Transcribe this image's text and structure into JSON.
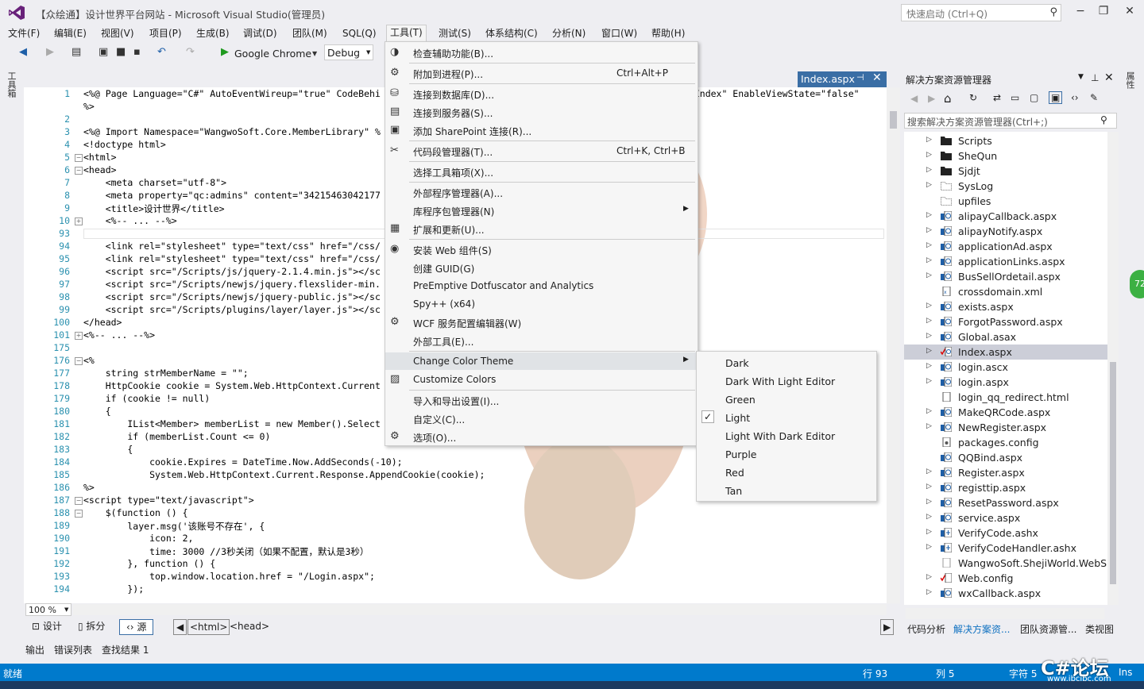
{
  "window": {
    "title": "【众绘通】设计世界平台网站 - Microsoft Visual Studio(管理员)",
    "quick_launch_placeholder": "快速启动 (Ctrl+Q)",
    "minimize": "−",
    "restore": "❐",
    "close": "✕"
  },
  "menu": [
    "文件(F)",
    "编辑(E)",
    "视图(V)",
    "项目(P)",
    "生成(B)",
    "调试(D)",
    "团队(M)",
    "SQL(Q)",
    "工具(T)",
    "测试(S)",
    "体系结构(C)",
    "分析(N)",
    "窗口(W)",
    "帮助(H)"
  ],
  "toolbar": {
    "browser": "Google Chrome",
    "config": "Debug"
  },
  "toolbox_label": "工具箱",
  "document_tab": {
    "label": "Index.aspx",
    "pin": "⊣",
    "close": "✕"
  },
  "editor": {
    "zoom": "100 %",
    "lines": [
      {
        "n": "1",
        "text": "<%@ Page Language=\"C#\" AutoEventWireup=\"true\" CodeBehi"
      },
      {
        "n": "",
        "text": "%>"
      },
      {
        "n": "2",
        "text": ""
      },
      {
        "n": "3",
        "text": "<%@ Import Namespace=\"WangwoSoft.Core.MemberLibrary\" %"
      },
      {
        "n": "4",
        "text": "<!doctype html>"
      },
      {
        "n": "5",
        "text": "<html>"
      },
      {
        "n": "6",
        "text": "<head>"
      },
      {
        "n": "7",
        "text": "    <meta charset=\"utf-8\">"
      },
      {
        "n": "8",
        "text": "    <meta property=\"qc:admins\" content=\"34215463042177"
      },
      {
        "n": "9",
        "text": "    <title>设计世界</title>"
      },
      {
        "n": "10",
        "text": "    <%-- ... --%>"
      },
      {
        "n": "93",
        "text": ""
      },
      {
        "n": "94",
        "text": "    <link rel=\"stylesheet\" type=\"text/css\" href=\"/css/"
      },
      {
        "n": "95",
        "text": "    <link rel=\"stylesheet\" type=\"text/css\" href=\"/css/"
      },
      {
        "n": "96",
        "text": "    <script src=\"/Scripts/js/jquery-2.1.4.min.js\"></sc"
      },
      {
        "n": "97",
        "text": "    <script src=\"/Scripts/newjs/jquery.flexslider-min."
      },
      {
        "n": "98",
        "text": "    <script src=\"/Scripts/newjs/jquery-public.js\"></sc"
      },
      {
        "n": "99",
        "text": "    <script src=\"/Scripts/plugins/layer/layer.js\"></sc"
      },
      {
        "n": "100",
        "text": "</head>"
      },
      {
        "n": "101",
        "text": "<%-- ... --%>"
      },
      {
        "n": "175",
        "text": ""
      },
      {
        "n": "176",
        "text": "<%"
      },
      {
        "n": "177",
        "text": "    string strMemberName = \"\";"
      },
      {
        "n": "178",
        "text": "    HttpCookie cookie = System.Web.HttpContext.Current"
      },
      {
        "n": "179",
        "text": "    if (cookie != null)"
      },
      {
        "n": "180",
        "text": "    {"
      },
      {
        "n": "181",
        "text": "        IList<Member> memberList = new Member().Select"
      },
      {
        "n": "182",
        "text": "        if (memberList.Count <= 0)"
      },
      {
        "n": "183",
        "text": "        {"
      },
      {
        "n": "184",
        "text": "            cookie.Expires = DateTime.Now.AddSeconds(-10);"
      },
      {
        "n": "185",
        "text": "            System.Web.HttpContext.Current.Response.AppendCookie(cookie);"
      },
      {
        "n": "186",
        "text": "%>"
      },
      {
        "n": "187",
        "text": "<script type=\"text/javascript\">"
      },
      {
        "n": "188",
        "text": "    $(function () {"
      },
      {
        "n": "189",
        "text": "        layer.msg('该账号不存在', {"
      },
      {
        "n": "190",
        "text": "            icon: 2,"
      },
      {
        "n": "191",
        "text": "            time: 3000 //3秒关闭（如果不配置，默认是3秒）"
      },
      {
        "n": "192",
        "text": "        }, function () {"
      },
      {
        "n": "193",
        "text": "            top.window.location.href = \"/Login.aspx\";"
      },
      {
        "n": "194",
        "text": "        });"
      }
    ],
    "right_fragment": "e.Index\" EnableViewState=\"false\""
  },
  "viewbar": {
    "design": "设计",
    "split": "拆分",
    "source": "源",
    "crumbs": [
      "<html>",
      "<head>"
    ]
  },
  "output_tabs": [
    "输出",
    "错误列表",
    "查找结果 1"
  ],
  "status": {
    "ready": "就绪",
    "line": "行 93",
    "col": "列 5",
    "char": "字符 5",
    "ins": "Ins"
  },
  "watermark": {
    "text": "C#论坛",
    "url": "www.ibcibc.com"
  },
  "solution": {
    "title": "解决方案资源管理器",
    "search_placeholder": "搜索解决方案资源管理器(Ctrl+;)",
    "items": [
      {
        "name": "Scripts",
        "type": "folder",
        "expand": true
      },
      {
        "name": "SheQun",
        "type": "folder",
        "expand": true
      },
      {
        "name": "Sjdjt",
        "type": "folder",
        "expand": true
      },
      {
        "name": "SysLog",
        "type": "folder-empty",
        "expand": true
      },
      {
        "name": "upfiles",
        "type": "folder-empty",
        "expand": false
      },
      {
        "name": "alipayCallback.aspx",
        "type": "aspx",
        "expand": true
      },
      {
        "name": "alipayNotify.aspx",
        "type": "aspx",
        "expand": true
      },
      {
        "name": "applicationAd.aspx",
        "type": "aspx",
        "expand": true
      },
      {
        "name": "applicationLinks.aspx",
        "type": "aspx",
        "expand": true
      },
      {
        "name": "BusSellOrdetail.aspx",
        "type": "aspx",
        "expand": true
      },
      {
        "name": "crossdomain.xml",
        "type": "xml",
        "expand": false
      },
      {
        "name": "exists.aspx",
        "type": "aspx",
        "expand": true
      },
      {
        "name": "ForgotPassword.aspx",
        "type": "aspx",
        "expand": true
      },
      {
        "name": "Global.asax",
        "type": "aspx",
        "expand": true
      },
      {
        "name": "Index.aspx",
        "type": "aspx-check",
        "expand": true,
        "selected": true
      },
      {
        "name": "login.ascx",
        "type": "aspx",
        "expand": true
      },
      {
        "name": "login.aspx",
        "type": "aspx",
        "expand": true
      },
      {
        "name": "login_qq_redirect.html",
        "type": "html",
        "expand": false
      },
      {
        "name": "MakeQRCode.aspx",
        "type": "aspx",
        "expand": true
      },
      {
        "name": "NewRegister.aspx",
        "type": "aspx",
        "expand": true
      },
      {
        "name": "packages.config",
        "type": "config",
        "expand": false
      },
      {
        "name": "QQBind.aspx",
        "type": "aspx",
        "expand": false
      },
      {
        "name": "Register.aspx",
        "type": "aspx",
        "expand": true
      },
      {
        "name": "registtip.aspx",
        "type": "aspx",
        "expand": true
      },
      {
        "name": "ResetPassword.aspx",
        "type": "aspx",
        "expand": true
      },
      {
        "name": "service.aspx",
        "type": "aspx",
        "expand": true
      },
      {
        "name": "VerifyCode.ashx",
        "type": "ashx",
        "expand": true
      },
      {
        "name": "VerifyCodeHandler.ashx",
        "type": "ashx",
        "expand": true
      },
      {
        "name": "WangwoSoft.ShejiWorld.WebSit",
        "type": "file",
        "expand": false
      },
      {
        "name": "Web.config",
        "type": "config-check",
        "expand": true
      },
      {
        "name": "wxCallback.aspx",
        "type": "aspx",
        "expand": true
      }
    ],
    "tabs": [
      "代码分析",
      "解决方案资...",
      "团队资源管...",
      "类视图"
    ]
  },
  "right_strip_label": "属性",
  "badge": "72",
  "tools_menu": [
    {
      "label": "检查辅助功能(B)...",
      "shortcut": "",
      "icon": "accessibility-icon",
      "sep_after": true
    },
    {
      "label": "附加到进程(P)...",
      "shortcut": "Ctrl+Alt+P",
      "icon": "attach-process-icon",
      "sep_after": true
    },
    {
      "label": "连接到数据库(D)...",
      "shortcut": "",
      "icon": "database-icon"
    },
    {
      "label": "连接到服务器(S)...",
      "shortcut": "",
      "icon": "server-icon"
    },
    {
      "label": "添加 SharePoint 连接(R)...",
      "shortcut": "",
      "icon": "sharepoint-icon",
      "sep_after": true
    },
    {
      "label": "代码段管理器(T)...",
      "shortcut": "Ctrl+K, Ctrl+B",
      "icon": "snippet-icon",
      "sep_after": true
    },
    {
      "label": "选择工具箱项(X)...",
      "shortcut": "",
      "icon": "",
      "sep_after": true
    },
    {
      "label": "外部程序管理器(A)...",
      "shortcut": "",
      "icon": ""
    },
    {
      "label": "库程序包管理器(N)",
      "shortcut": "",
      "icon": "",
      "submenu": true
    },
    {
      "label": "扩展和更新(U)...",
      "shortcut": "",
      "icon": "extensions-icon",
      "sep_after": true
    },
    {
      "label": "安装 Web 组件(S)",
      "shortcut": "",
      "icon": "web-component-icon"
    },
    {
      "label": "创建 GUID(G)",
      "shortcut": "",
      "icon": ""
    },
    {
      "label": "PreEmptive Dotfuscator and Analytics",
      "shortcut": "",
      "icon": ""
    },
    {
      "label": "Spy++ (x64)",
      "shortcut": "",
      "icon": ""
    },
    {
      "label": "WCF 服务配置编辑器(W)",
      "shortcut": "",
      "icon": "wcf-icon"
    },
    {
      "label": "外部工具(E)...",
      "shortcut": "",
      "icon": "",
      "sep_after": true
    },
    {
      "label": "Change Color Theme",
      "shortcut": "",
      "icon": "",
      "submenu": true,
      "highlight": true
    },
    {
      "label": "Customize Colors",
      "shortcut": "",
      "icon": "customize-colors-icon",
      "sep_after": true
    },
    {
      "label": "导入和导出设置(I)...",
      "shortcut": "",
      "icon": ""
    },
    {
      "label": "自定义(C)...",
      "shortcut": "",
      "icon": ""
    },
    {
      "label": "选项(O)...",
      "shortcut": "",
      "icon": "gear-icon"
    }
  ],
  "theme_menu": [
    {
      "label": "Dark",
      "checked": false
    },
    {
      "label": "Dark With Light Editor",
      "checked": false
    },
    {
      "label": "Green",
      "checked": false
    },
    {
      "label": "Light",
      "checked": true
    },
    {
      "label": "Light With Dark Editor",
      "checked": false
    },
    {
      "label": "Purple",
      "checked": false
    },
    {
      "label": "Red",
      "checked": false
    },
    {
      "label": "Tan",
      "checked": false
    }
  ]
}
